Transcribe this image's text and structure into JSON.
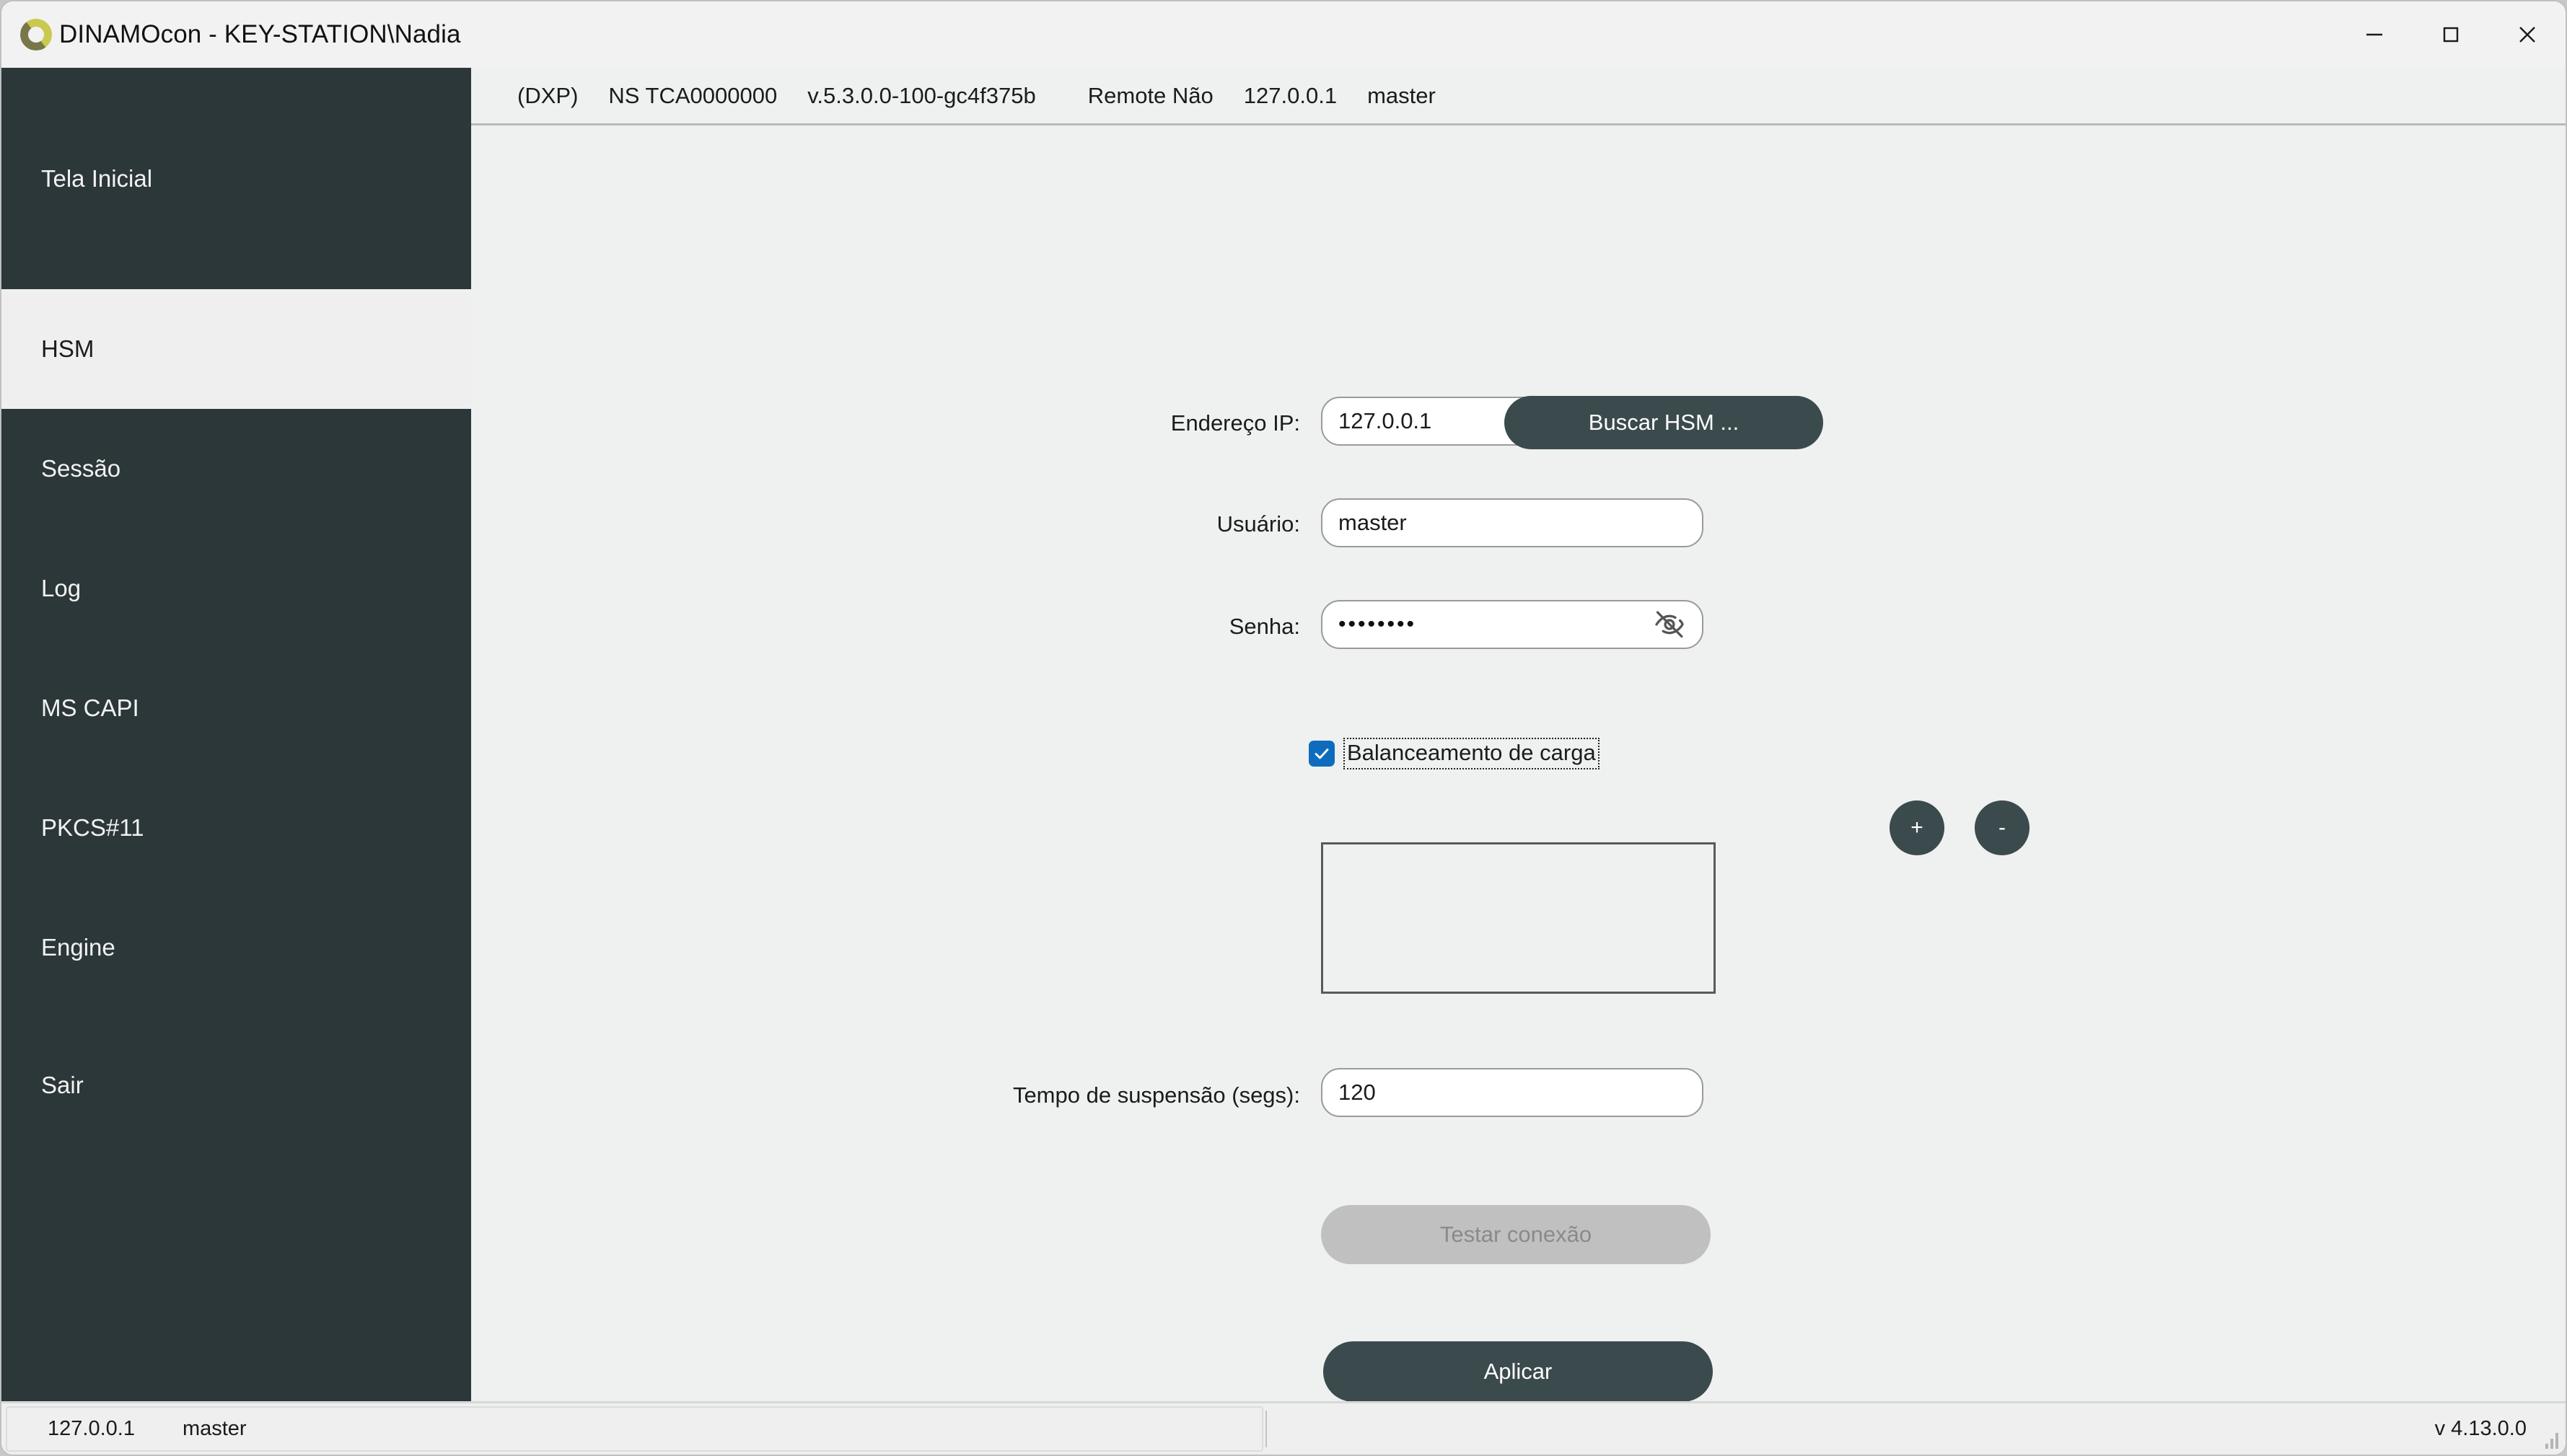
{
  "window": {
    "title": "DINAMOcon - KEY-STATION\\Nadia",
    "logo_icon": "dinamo-ring-logo",
    "controls": {
      "minimize": "minimize-icon",
      "maximize": "maximize-icon",
      "close": "close-icon"
    }
  },
  "topbar": {
    "mode": "(DXP)",
    "serial": "NS TCA0000000",
    "version": "v.5.3.0.0-100-gc4f375b",
    "remote": "Remote Não",
    "ip": "127.0.0.1",
    "user": "master"
  },
  "sidebar": {
    "items": [
      {
        "label": "Tela Inicial",
        "selected": false
      },
      {
        "label": "HSM",
        "selected": true
      },
      {
        "label": "Sessão",
        "selected": false
      },
      {
        "label": "Log",
        "selected": false
      },
      {
        "label": "MS CAPI",
        "selected": false
      },
      {
        "label": "PKCS#11",
        "selected": false
      },
      {
        "label": "Engine",
        "selected": false
      },
      {
        "label": "Sair",
        "selected": false
      }
    ]
  },
  "form": {
    "ip": {
      "label": "Endereço IP:",
      "value": "127.0.0.1",
      "placeholder": ""
    },
    "user": {
      "label": "Usuário:",
      "value": "master",
      "placeholder": ""
    },
    "password": {
      "label": "Senha:",
      "value": "••••••••",
      "placeholder": "",
      "toggle_icon": "eye-off-icon"
    },
    "load_balancing": {
      "label": "Balanceamento de carga",
      "checked": true,
      "check_icon": "check-icon"
    },
    "add_button": {
      "label": "+",
      "name": "add-icon"
    },
    "remove_button": {
      "label": "-",
      "name": "minus-icon"
    },
    "hsm_list": {
      "items": []
    },
    "suspend_time": {
      "label": "Tempo de suspensão (segs):",
      "value": "120",
      "placeholder": ""
    },
    "search_hsm_button": {
      "label": "Buscar HSM ...",
      "enabled": true
    },
    "test_connection_button": {
      "label": "Testar conexão",
      "enabled": false
    },
    "apply_button": {
      "label": "Aplicar",
      "enabled": true
    }
  },
  "statusbar": {
    "ip": "127.0.0.1",
    "user": "master",
    "version": "v 4.13.0.0"
  },
  "colors": {
    "sidebar_bg": "#2c3739",
    "accent_dark": "#3b4a4d",
    "page_bg": "#eff0f0",
    "checkbox_blue": "#0f6cbd",
    "disabled_bg": "#c0c0c0"
  }
}
